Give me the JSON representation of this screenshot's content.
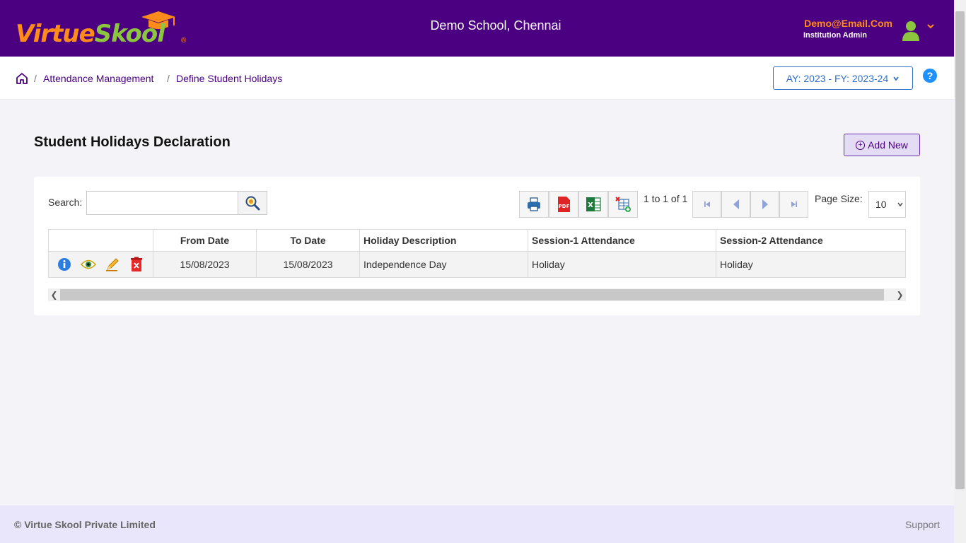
{
  "header": {
    "logo": {
      "part1": "Virtue",
      "part2": "Skool",
      "reg": "®"
    },
    "school_name": "Demo School, Chennai",
    "user_email": "Demo@Email.Com",
    "user_role": "Institution Admin"
  },
  "breadcrumb": {
    "items": [
      "Attendance Management",
      "Define Student Holidays"
    ],
    "separator": "/"
  },
  "ay_select": {
    "value": "AY: 2023 - FY: 2023-24"
  },
  "help": {
    "label": "?"
  },
  "page": {
    "title": "Student Holidays Declaration",
    "add_new_label": "Add New"
  },
  "toolbar": {
    "search_label": "Search:",
    "search_value": "",
    "paging_info": "1 to 1 of 1",
    "page_size_label": "Page Size:",
    "page_size_value": "10"
  },
  "table": {
    "columns": [
      "",
      "From Date",
      "To Date",
      "Holiday Description",
      "Session-1 Attendance",
      "Session-2 Attendance"
    ],
    "rows": [
      {
        "from": "15/08/2023",
        "to": "15/08/2023",
        "description": "Independence Day",
        "session1": "Holiday",
        "session2": "Holiday"
      }
    ]
  },
  "footer": {
    "copyright": "© Virtue Skool Private Limited",
    "support": "Support"
  },
  "colors": {
    "header_bg": "#4b0082",
    "accent_orange": "#ff8c1a",
    "accent_green": "#8cc63f",
    "link_blue": "#2f6fc7"
  }
}
